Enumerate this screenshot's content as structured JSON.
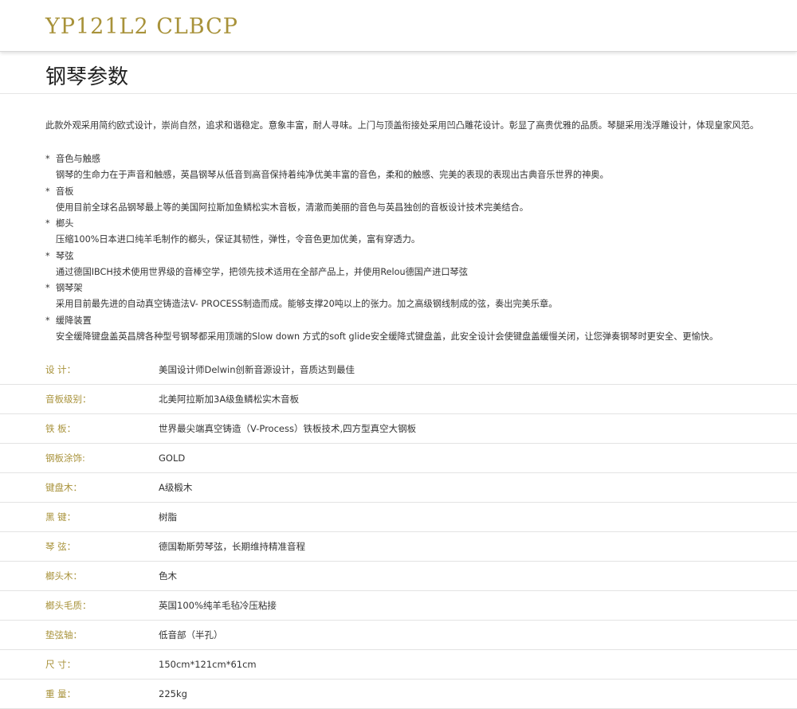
{
  "header": {
    "model": "YP121L2 CLBCP"
  },
  "section": {
    "title": "钢琴参数"
  },
  "intro": "此款外观采用简约欧式设计，崇尚自然，追求和谐稳定。意象丰富，耐人寻味。上门与顶盖衔接处采用凹凸雕花设计。彰显了高贵优雅的品质。琴腿采用浅浮雕设计，体现皇家风范。",
  "features": [
    {
      "bullet": "*",
      "title": "音色与触感",
      "desc": "钢琴的生命力在于声音和触感，英昌钢琴从低音到高音保持着纯净优美丰富的音色，柔和的触感、完美的表现的表现出古典音乐世界的神奥。"
    },
    {
      "bullet": "*",
      "title": "音板",
      "desc": "使用目前全球名品钢琴最上等的美国阿拉斯加鱼鳞松实木音板，清澈而美丽的音色与英昌独创的音板设计技术完美结合。"
    },
    {
      "bullet": "*",
      "title": "榔头",
      "desc": "压缩100%日本进口纯羊毛制作的榔头，保证其韧性，弹性，令音色更加优美，富有穿透力。"
    },
    {
      "bullet": "*",
      "title": "琴弦",
      "desc": "通过德国IBCH技术使用世界级的音棒空学，把领先技术适用在全部产品上，并使用Relou德国产进口琴弦"
    },
    {
      "bullet": "*",
      "title": "钢琴架",
      "desc": "采用目前最先进的自动真空铸造法V- PROCESS制造而成。能够支撑20吨以上的张力。加之高级钢线制成的弦，奏出完美乐章。"
    },
    {
      "bullet": "*",
      "title": "缓降装置",
      "desc": "安全缓降键盘盖英昌牌各种型号钢琴都采用顶端的Slow down 方式的soft glide安全缓降式键盘盖，此安全设计会使键盘盖缓慢关闭，让您弹奏钢琴时更安全、更愉快。"
    }
  ],
  "specs": [
    {
      "label": "设 计：",
      "value": "美国设计师Delwin创新音源设计，音质达到最佳"
    },
    {
      "label": "音板级别：",
      "value": "北美阿拉斯加3A级鱼鳞松实木音板"
    },
    {
      "label": "铁 板：",
      "value": "世界最尖端真空铸造（V-Process）铁板技术,四方型真空大钢板"
    },
    {
      "label": "钢板涂饰:",
      "value": "GOLD"
    },
    {
      "label": "键盘木：",
      "value": "A级椴木"
    },
    {
      "label": "黑 键：",
      "value": "树脂"
    },
    {
      "label": "琴 弦：",
      "value": "德国勒斯劳琴弦，长期维持精准音程"
    },
    {
      "label": "榔头木：",
      "value": "色木"
    },
    {
      "label": "榔头毛质：",
      "value": "英国100%纯羊毛毡冷压粘接"
    },
    {
      "label": "垫弦轴：",
      "value": "低音部（半孔）"
    },
    {
      "label": "尺 寸：",
      "value": "150cm*121cm*61cm"
    },
    {
      "label": "重 量：",
      "value": "225kg"
    }
  ],
  "colors": {
    "accent": "#a8923a",
    "text": "#333333",
    "divider": "#e3e3e3"
  }
}
